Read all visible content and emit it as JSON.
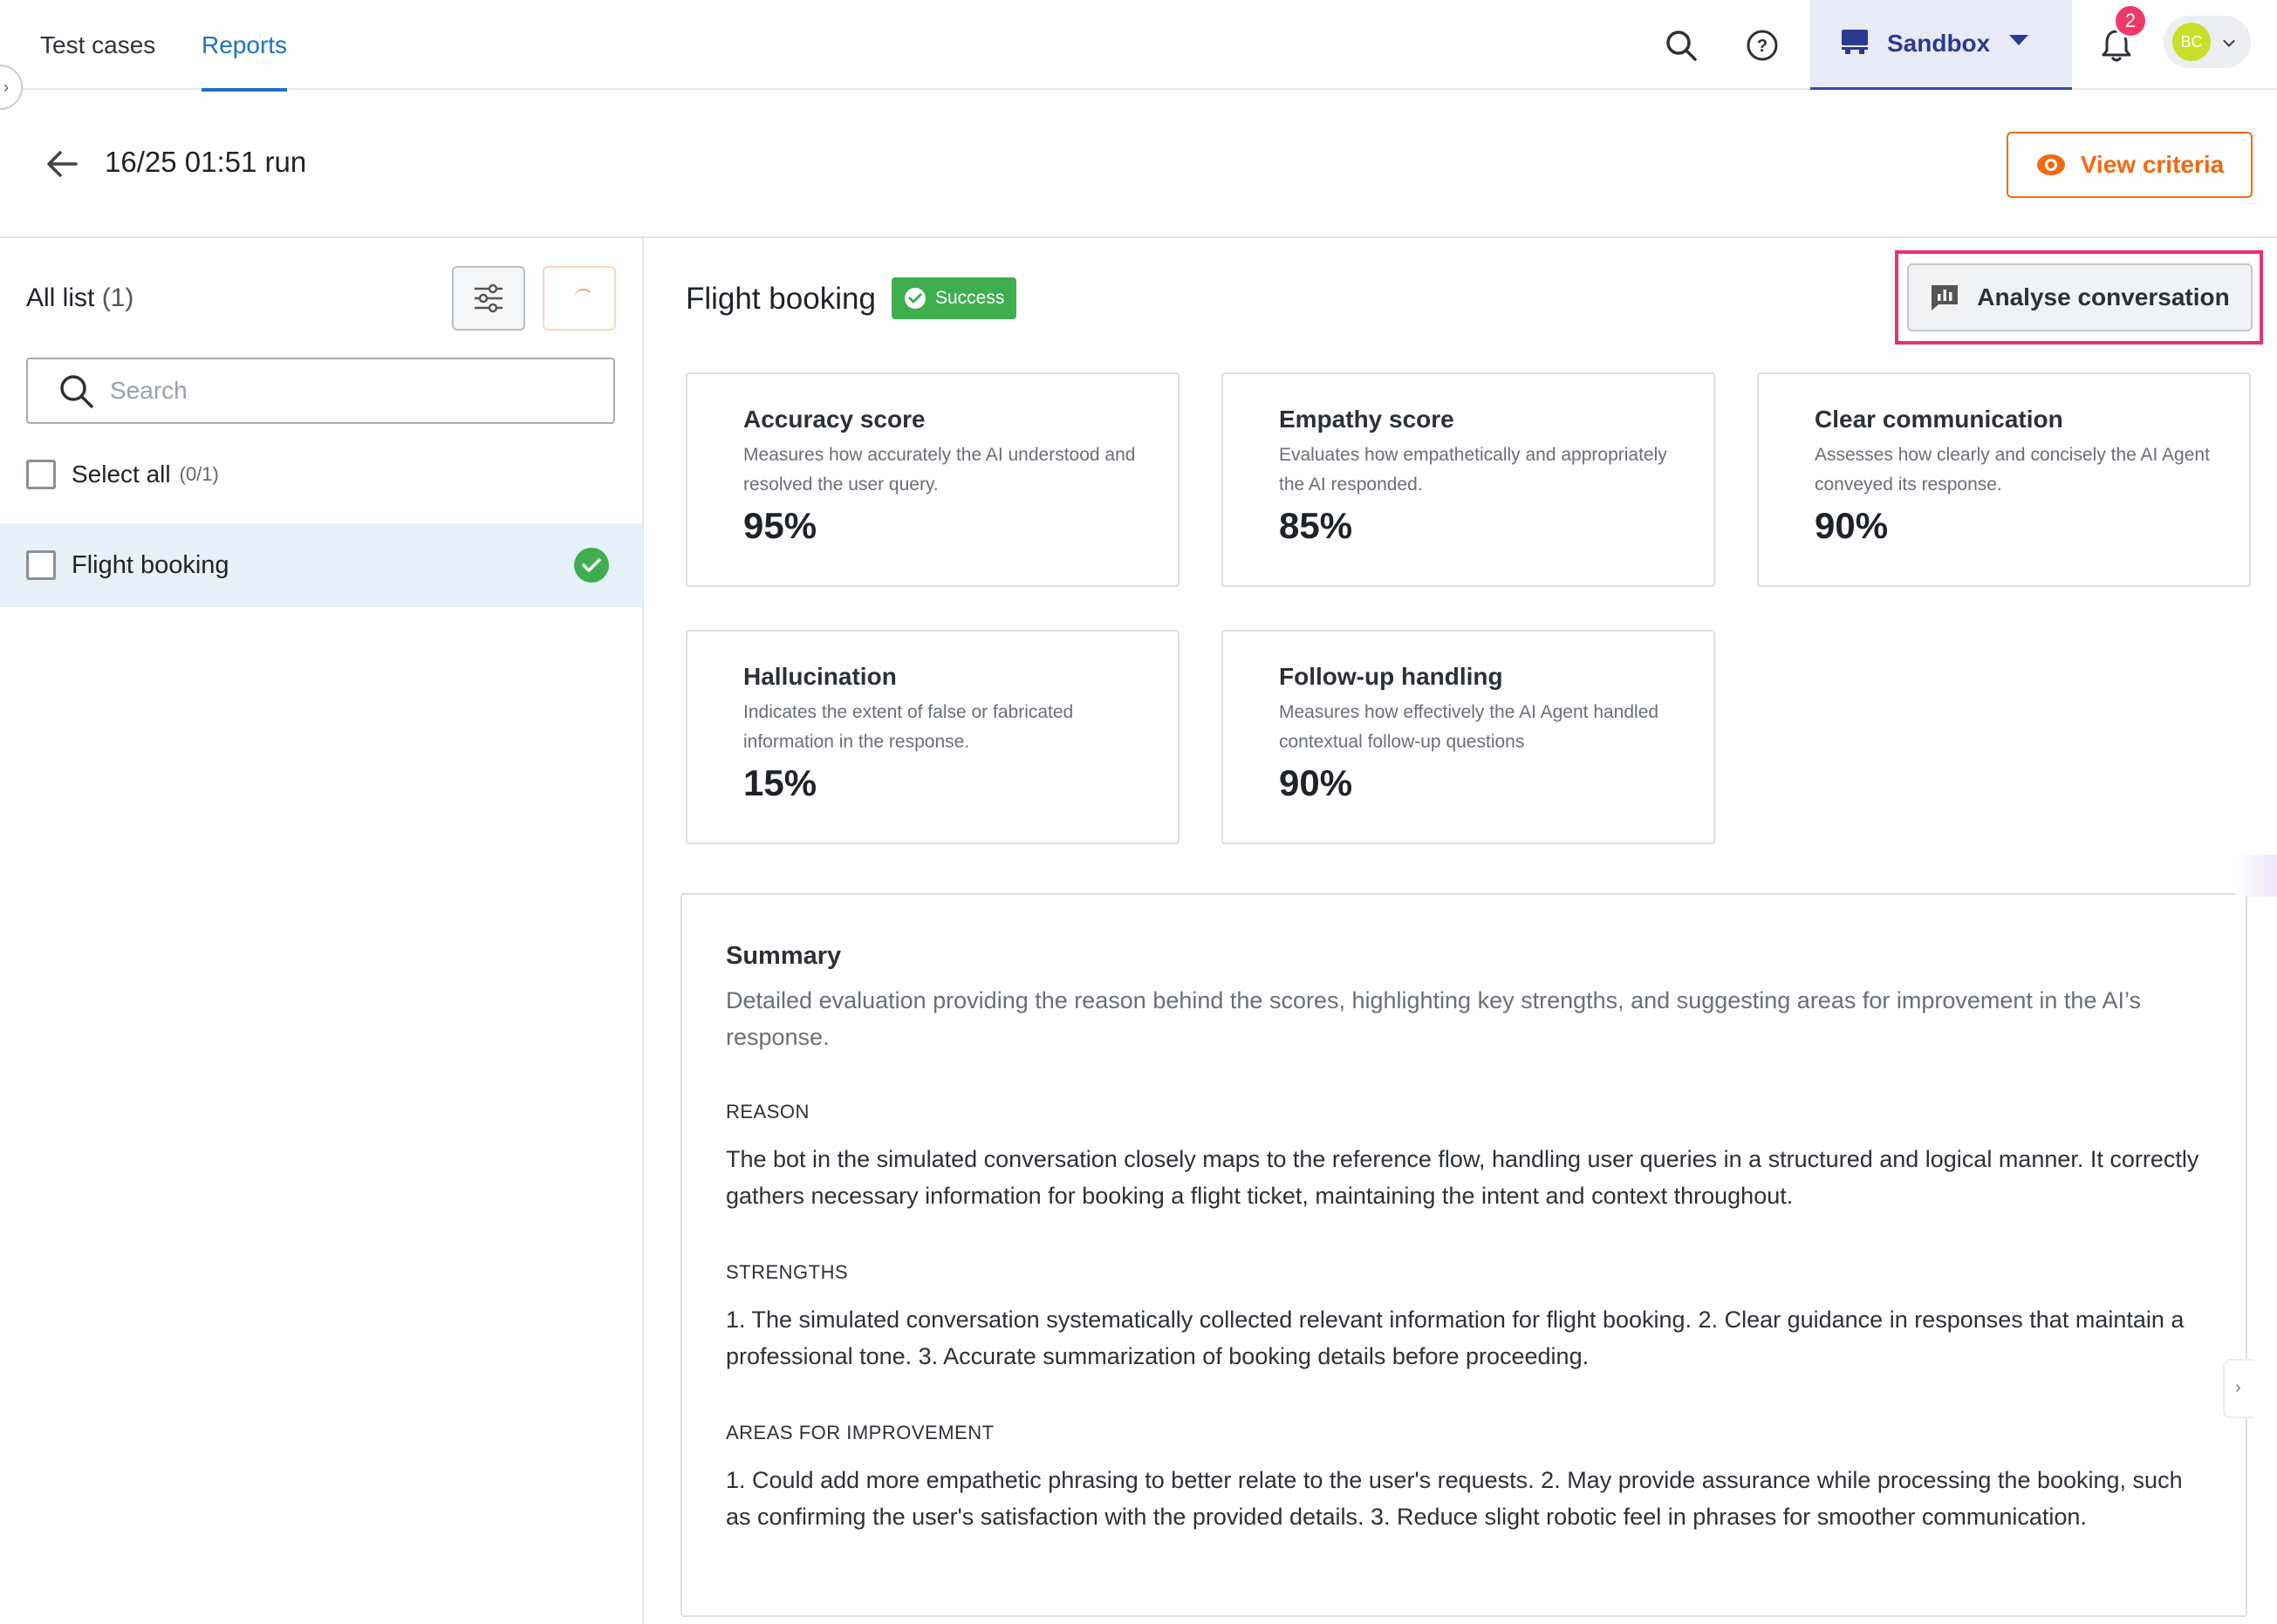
{
  "nav": {
    "tabs": [
      {
        "label": "Test cases",
        "active": false
      },
      {
        "label": "Reports",
        "active": true
      }
    ],
    "workspace": "Sandbox",
    "notification_count": "2",
    "avatar_initials": "BC",
    "icons": [
      "search-icon",
      "help-icon",
      "workspace-icon",
      "bell-icon",
      "chevron-down-icon"
    ]
  },
  "run": {
    "title": "16/25 01:51 run",
    "view_criteria_label": "View criteria"
  },
  "sidebar": {
    "list_title": "All list",
    "list_count": "(1)",
    "search_placeholder": "Search",
    "select_all_label": "Select all",
    "select_all_count": "(0/1)",
    "items": [
      {
        "label": "Flight booking",
        "status": "success"
      }
    ]
  },
  "detail": {
    "title": "Flight booking",
    "status_label": "Success",
    "analyse_label": "Analyse conversation",
    "metrics": [
      {
        "title": "Accuracy score",
        "description": "Measures how accurately the AI understood and resolved the user query.",
        "value": "95%"
      },
      {
        "title": "Empathy score",
        "description": "Evaluates how empathetically and appropriately the AI responded.",
        "value": "85%"
      },
      {
        "title": "Clear communication",
        "description": "Assesses how clearly and concisely the AI Agent conveyed its response.",
        "value": "90%"
      },
      {
        "title": "Hallucination",
        "description": "Indicates the extent of false or fabricated information in the response.",
        "value": "15%"
      },
      {
        "title": "Follow-up handling",
        "description": "Measures how effectively the AI Agent handled contextual follow-up questions",
        "value": "90%"
      }
    ],
    "summary": {
      "title": "Summary",
      "description": "Detailed evaluation providing the reason behind the scores, highlighting key strengths, and suggesting areas for improvement in the AI’s response.",
      "reason_heading": "REASON",
      "reason": "The bot in the simulated conversation closely maps to the reference flow, handling user queries in a structured and logical manner. It correctly gathers necessary information for booking a flight ticket, maintaining the intent and context throughout.",
      "strengths_heading": "STRENGTHS",
      "strengths": "1. The simulated conversation systematically collected relevant information for flight booking. 2. Clear guidance in responses that maintain a professional tone. 3. Accurate summarization of booking details before proceeding.",
      "improvement_heading": "AREAS FOR IMPROVEMENT",
      "improvement": "1. Could add more empathetic phrasing to better relate to the user's requests. 2. May provide assurance while processing the booking, such as confirming the user's satisfaction with the provided details. 3. Reduce slight robotic feel in phrases for smoother communication."
    }
  },
  "colors": {
    "accent_blue": "#1a73c8",
    "orange": "#f26a0f",
    "success_green": "#3eae4f",
    "highlight_pink": "#e8336e",
    "sandbox_bg": "#e8eaf7"
  }
}
